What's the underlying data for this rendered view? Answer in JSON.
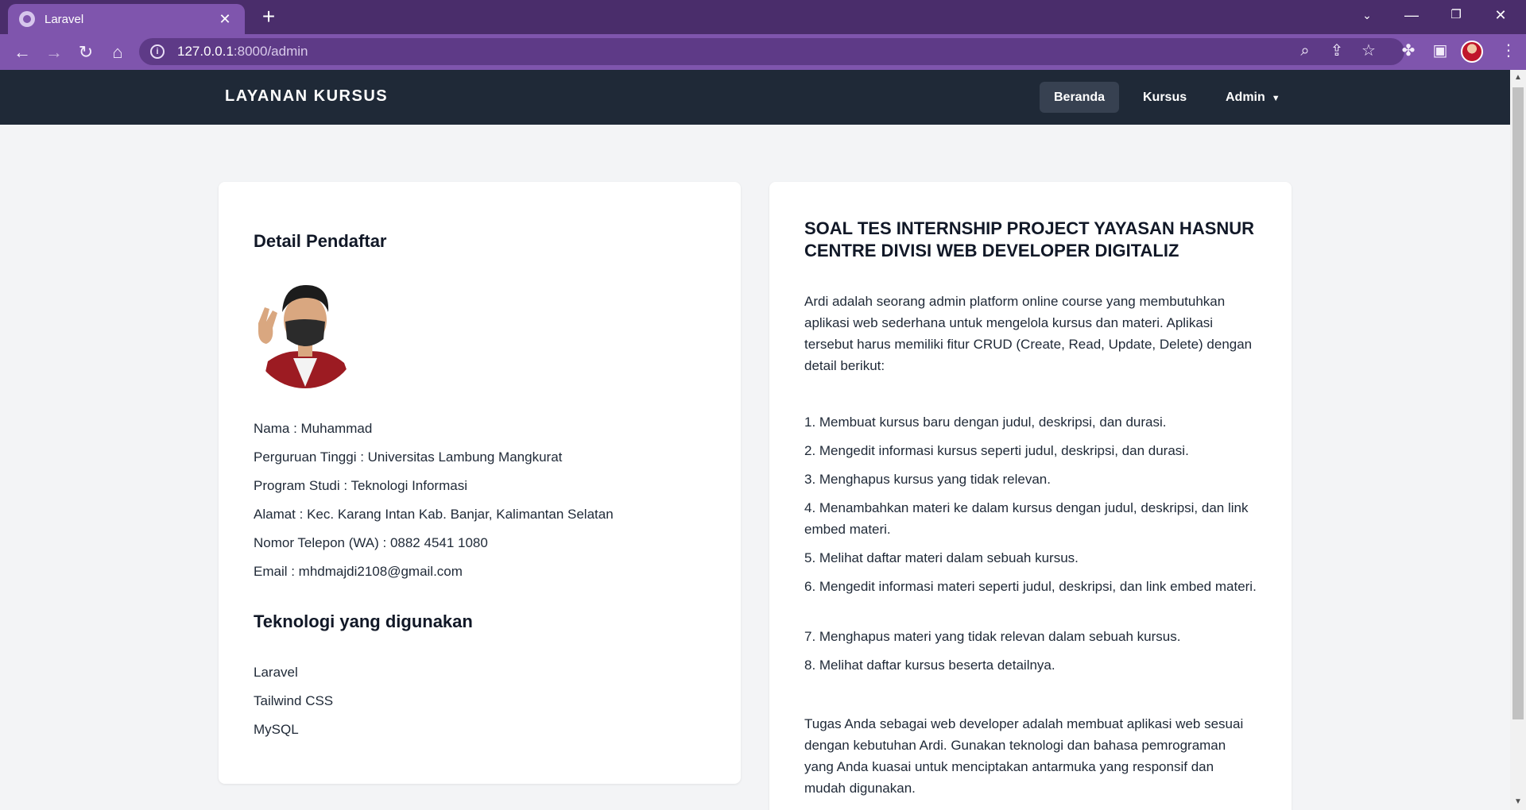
{
  "browser": {
    "tab_title": "Laravel",
    "url_host": "127.0.0.1",
    "url_rest": ":8000/admin"
  },
  "navbar": {
    "brand": "LAYANAN KURSUS",
    "links": [
      {
        "label": "Beranda",
        "active": true
      },
      {
        "label": "Kursus",
        "active": false
      },
      {
        "label": "Admin",
        "active": false
      }
    ]
  },
  "left_card": {
    "title": "Detail Pendaftar",
    "details": [
      "Nama : Muhammad",
      "Perguruan Tinggi : Universitas Lambung Mangkurat",
      "Program Studi : Teknologi Informasi",
      "Alamat : Kec. Karang Intan Kab. Banjar, Kalimantan Selatan",
      "Nomor Telepon (WA) : 0882 4541 1080",
      "Email : mhdmajdi2108@gmail.com"
    ],
    "tech_title": "Teknologi yang digunakan",
    "tech": [
      "Laravel",
      "Tailwind CSS",
      "MySQL"
    ]
  },
  "right_card": {
    "title": "SOAL TES INTERNSHIP PROJECT YAYASAN HASNUR CENTRE DIVISI WEB DEVELOPER DIGITALIZ",
    "intro": "Ardi adalah seorang admin platform online course yang membutuhkan aplikasi web sederhana untuk mengelola kursus dan materi. Aplikasi tersebut harus memiliki fitur CRUD (Create, Read, Update, Delete) dengan detail berikut:",
    "items": [
      "1. Membuat kursus baru dengan judul, deskripsi, dan durasi.",
      "2. Mengedit informasi kursus seperti judul, deskripsi, dan durasi.",
      "3. Menghapus kursus yang tidak relevan.",
      "4. Menambahkan materi ke dalam kursus dengan judul, deskripsi, dan link embed materi.",
      "5. Melihat daftar materi dalam sebuah kursus.",
      "6. Mengedit informasi materi seperti judul, deskripsi, dan link embed materi.",
      "7. Menghapus materi yang tidak relevan dalam sebuah kursus.",
      "8. Melihat daftar kursus beserta detailnya."
    ],
    "outro": "Tugas Anda sebagai web developer adalah membuat aplikasi web sesuai dengan kebutuhan Ardi. Gunakan teknologi dan bahasa pemrograman yang Anda kuasai untuk menciptakan antarmuka yang responsif dan mudah digunakan."
  }
}
